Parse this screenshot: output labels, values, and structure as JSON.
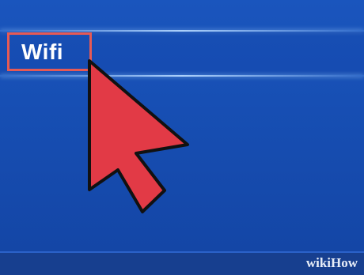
{
  "menu": {
    "selected_item_label": "Wifi"
  },
  "cursor": {
    "icon": "pointer-arrow-icon",
    "color": "#e23a46"
  },
  "highlight": {
    "color": "#e65a55"
  },
  "watermark": {
    "text_light": "wiki",
    "text_bold": "How"
  },
  "colors": {
    "background": "#174fb4",
    "frame": "#8ec29a"
  }
}
